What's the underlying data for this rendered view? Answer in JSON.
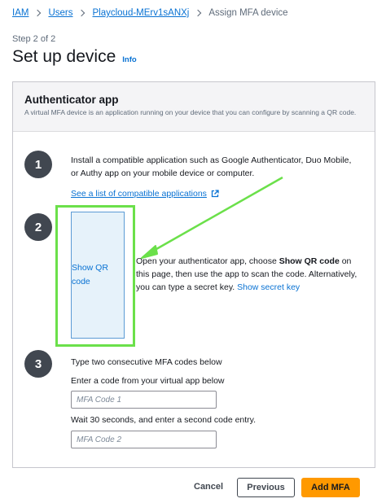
{
  "breadcrumb": {
    "items": [
      "IAM",
      "Users",
      "Playcloud-MErv1sANXj"
    ],
    "current": "Assign MFA device"
  },
  "header": {
    "step_label": "Step 2 of 2",
    "title": "Set up device",
    "info": "Info"
  },
  "panel": {
    "title": "Authenticator app",
    "description": "A virtual MFA device is an application running on your device that you can configure by scanning a QR code."
  },
  "steps": {
    "one": {
      "number": "1",
      "text": "Install a compatible application such as Google Authenticator, Duo Mobile, or Authy app on your mobile device or computer.",
      "link": "See a list of compatible applications"
    },
    "two": {
      "number": "2",
      "qr_link": "Show QR code",
      "text_a": "Open your authenticator app, choose ",
      "text_bold": "Show QR code",
      "text_b": " on this page, then use the app to scan the code. Alternatively, you can type a secret key. ",
      "secret_link": "Show secret key"
    },
    "three": {
      "number": "3",
      "title": "Type two consecutive MFA codes below",
      "label1": "Enter a code from your virtual app below",
      "placeholder1": "MFA Code 1",
      "label2": "Wait 30 seconds, and enter a second code entry.",
      "placeholder2": "MFA Code 2"
    }
  },
  "footer": {
    "cancel": "Cancel",
    "previous": "Previous",
    "add": "Add MFA"
  },
  "colors": {
    "link": "#0972d3",
    "primary_button": "#ff9900",
    "highlight": "#6be04a",
    "step_circle": "#414750"
  },
  "icons": {
    "external_link": "external-link-icon",
    "separator": "chevron-right-icon",
    "annotation_arrow": "arrow-icon"
  }
}
